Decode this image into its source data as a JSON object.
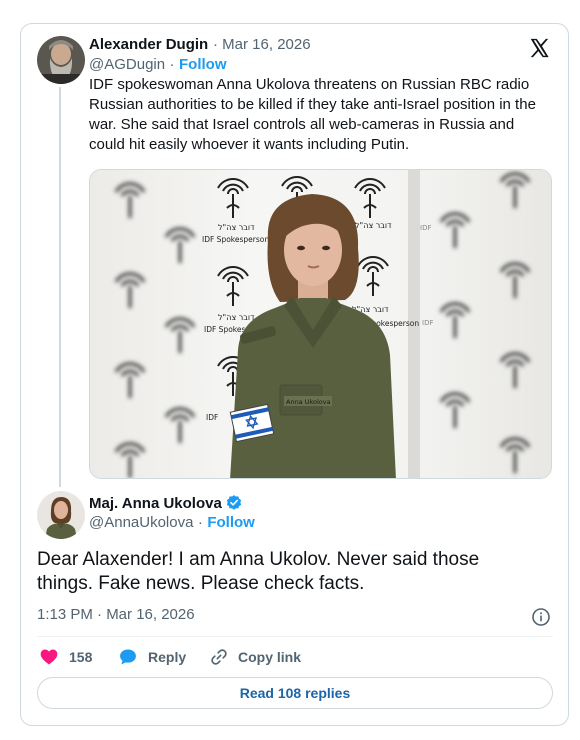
{
  "tweet": {
    "author_name": "Alexander Dugin",
    "date": "Mar 16, 2026",
    "handle": "@AGDugin",
    "follow_label": "Follow",
    "sep": "·",
    "text": "IDF spokeswoman Anna Ukolova threatens on Russian RBC radio Russian authorities to be killed if they take anti-Israel position in the war. She said that Israel controls all web-cameras in Russia and could hit easily whoever  it wants including Putin.",
    "platform_icon": "x-logo-icon",
    "media": {
      "backdrop_hebrew": "דובר צה\"ל",
      "backdrop_english": "IDF Spokesperson",
      "backdrop_short": "IDF",
      "name_tag": "Anna Ukolova",
      "flag": "israel-flag-patch"
    }
  },
  "reply": {
    "author_name": "Maj. Anna Ukolova",
    "verified_icon": "verified-badge-icon",
    "handle": "@AnnaUkolova",
    "sep": "·",
    "follow_label": "Follow",
    "text": "Dear Alaxender! I am Anna Ukolov. Never said those things. Fake news. Please check facts.",
    "time": "1:13 PM · Mar 16, 2026",
    "info_icon": "info-icon"
  },
  "actions": {
    "like_count": "158",
    "reply_label": "Reply",
    "copy_label": "Copy link"
  },
  "read_replies_label": "Read 108 replies",
  "colors": {
    "accent": "#1d9bf0",
    "like": "#f91880",
    "text": "#0f1419",
    "muted": "#536471",
    "border": "#cfd9de",
    "uniform": "#59603f"
  }
}
